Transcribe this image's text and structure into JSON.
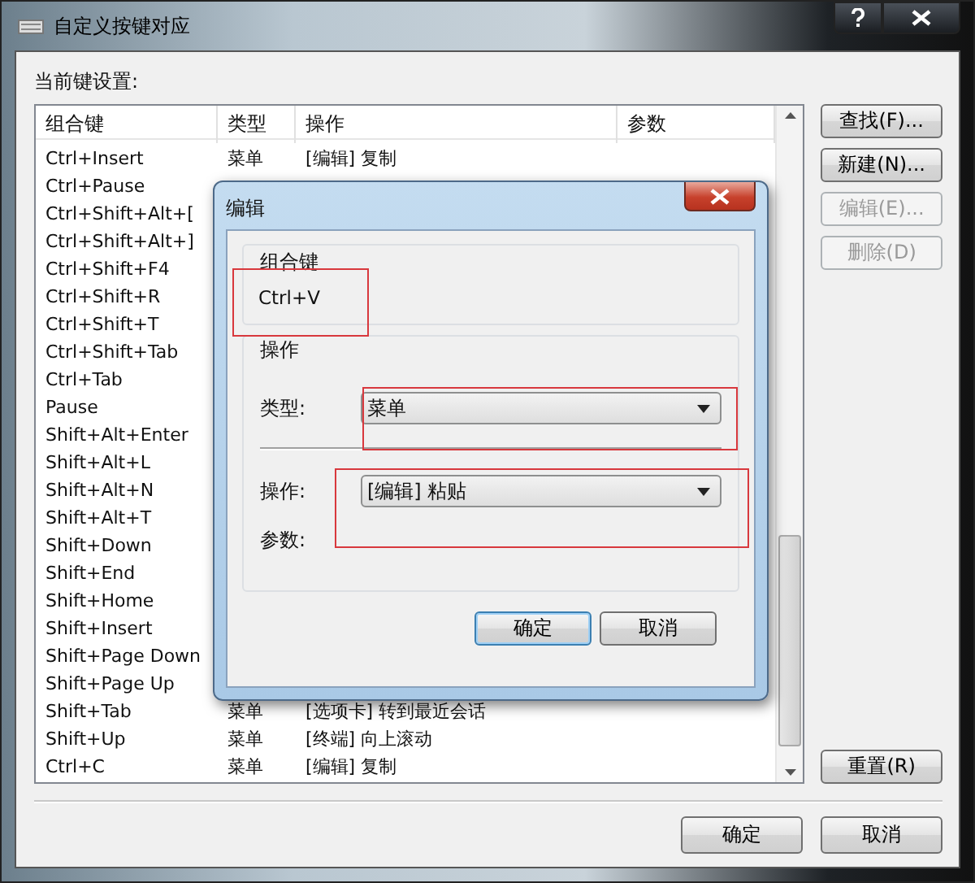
{
  "window": {
    "title": "自定义按键对应"
  },
  "list_label": "当前键设置:",
  "table": {
    "columns": [
      "组合键",
      "类型",
      "操作",
      "参数"
    ],
    "rows": [
      {
        "key": "Ctrl+Insert",
        "type": "菜单",
        "action": "[编辑] 复制"
      },
      {
        "key": "Ctrl+Pause"
      },
      {
        "key": "Ctrl+Shift+Alt+["
      },
      {
        "key": "Ctrl+Shift+Alt+]"
      },
      {
        "key": "Ctrl+Shift+F4"
      },
      {
        "key": "Ctrl+Shift+R"
      },
      {
        "key": "Ctrl+Shift+T"
      },
      {
        "key": "Ctrl+Shift+Tab"
      },
      {
        "key": "Ctrl+Tab"
      },
      {
        "key": "Pause"
      },
      {
        "key": "Shift+Alt+Enter"
      },
      {
        "key": "Shift+Alt+L"
      },
      {
        "key": "Shift+Alt+N"
      },
      {
        "key": "Shift+Alt+T"
      },
      {
        "key": "Shift+Down"
      },
      {
        "key": "Shift+End"
      },
      {
        "key": "Shift+Home"
      },
      {
        "key": "Shift+Insert"
      },
      {
        "key": "Shift+Page Down"
      },
      {
        "key": "Shift+Page Up"
      },
      {
        "key": "Shift+Tab",
        "type": "菜单",
        "action": "[选项卡] 转到最近会话"
      },
      {
        "key": "Shift+Up",
        "type": "菜单",
        "action": "[终端] 向上滚动"
      },
      {
        "key": "Ctrl+C",
        "type": "菜单",
        "action": "[编辑] 复制"
      }
    ]
  },
  "side_buttons": [
    {
      "label": "查找(F)...",
      "disabled": false
    },
    {
      "label": "新建(N)...",
      "disabled": false
    },
    {
      "label": "编辑(E)...",
      "disabled": true
    },
    {
      "label": "删除(D)",
      "disabled": true
    }
  ],
  "reset_button": "重置(R)",
  "footer_buttons": [
    "确定",
    "取消"
  ],
  "dialog": {
    "title": "编辑",
    "key_group": "组合键",
    "key_value": "Ctrl+V",
    "action_group": "操作",
    "type_label": "类型:",
    "type_value": "菜单",
    "action_label": "操作:",
    "action_value": "[编辑] 粘贴",
    "param_label": "参数:",
    "buttons": [
      {
        "label": "确定",
        "default": true
      },
      {
        "label": "取消",
        "default": false
      }
    ]
  }
}
